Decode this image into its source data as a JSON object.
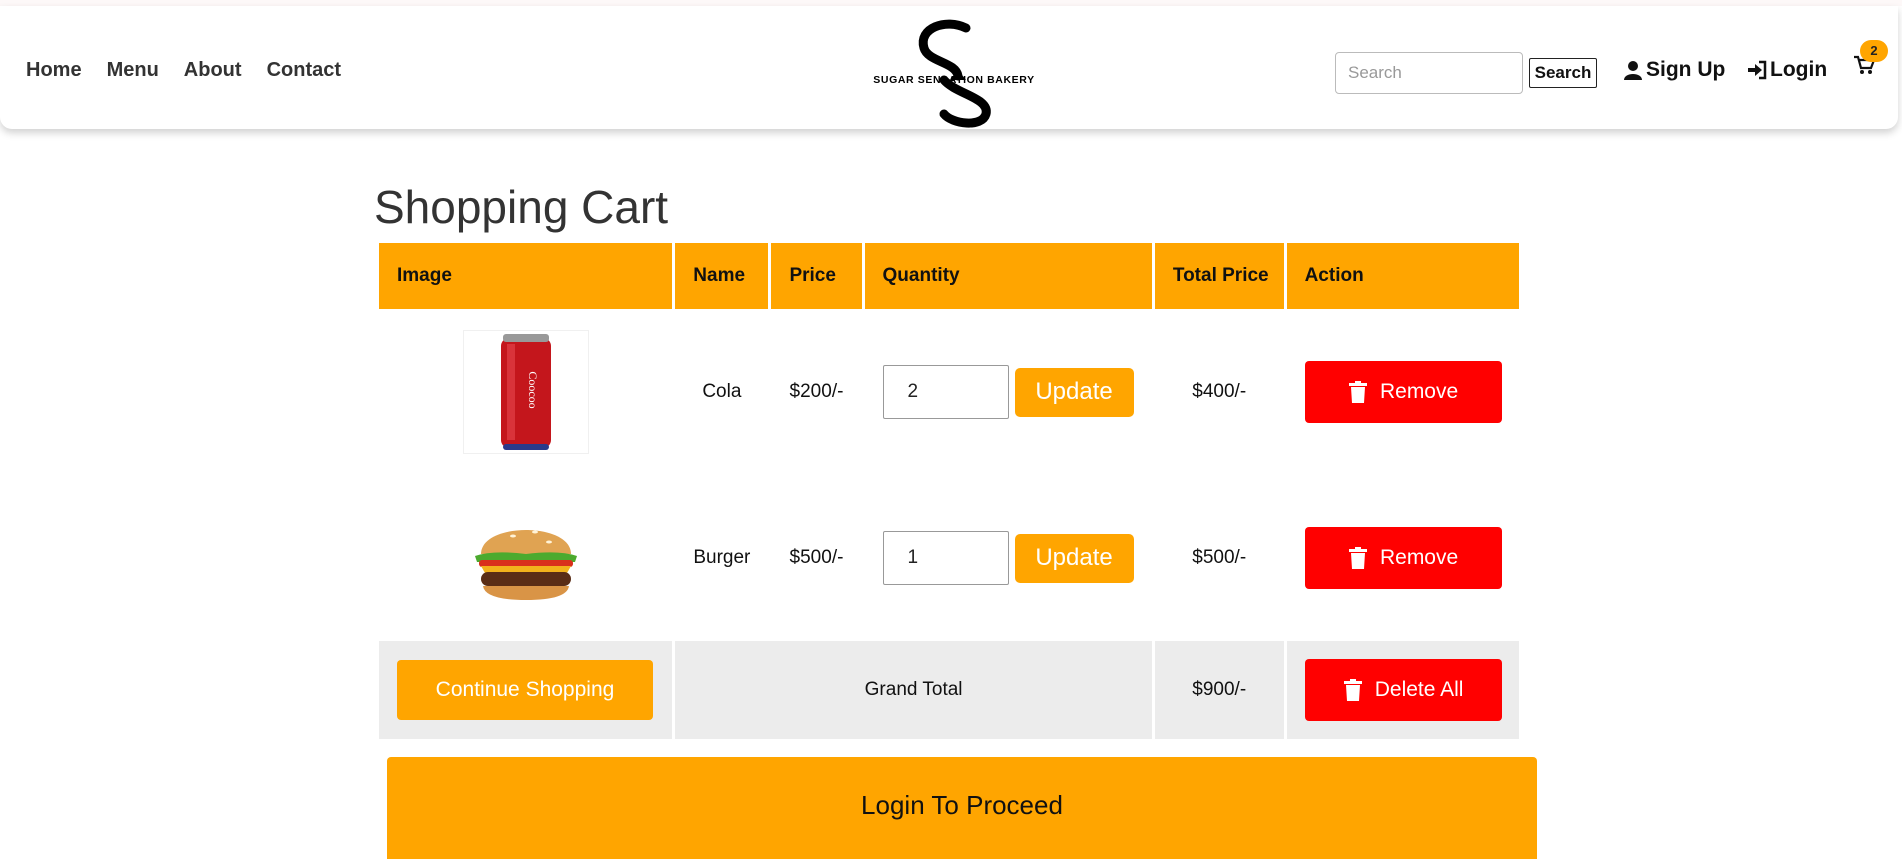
{
  "nav": {
    "home": "Home",
    "menu": "Menu",
    "about": "About",
    "contact": "Contact"
  },
  "logo": {
    "text": "SUGAR SENSATION BAKERY"
  },
  "search": {
    "placeholder": "Search",
    "button": "Search"
  },
  "account": {
    "signup": "Sign Up",
    "login": "Login"
  },
  "cart_badge": "2",
  "page_title": "Shopping Cart",
  "table": {
    "headers": [
      "Image",
      "Name",
      "Price",
      "Quantity",
      "Total Price",
      "Action"
    ],
    "items": [
      {
        "name": "Cola",
        "price": "$200/-",
        "quantity": "2",
        "total": "$400/-",
        "update": "Update",
        "remove": "Remove",
        "image": "cola-can"
      },
      {
        "name": "Burger",
        "price": "$500/-",
        "quantity": "1",
        "total": "$500/-",
        "update": "Update",
        "remove": "Remove",
        "image": "burger"
      }
    ],
    "continue": "Continue Shopping",
    "grand_total_label": "Grand Total",
    "grand_total": "$900/-",
    "delete_all": "Delete All"
  },
  "proceed": "Login To Proceed",
  "colors": {
    "accent": "#ffa500",
    "danger": "#ff0000"
  }
}
